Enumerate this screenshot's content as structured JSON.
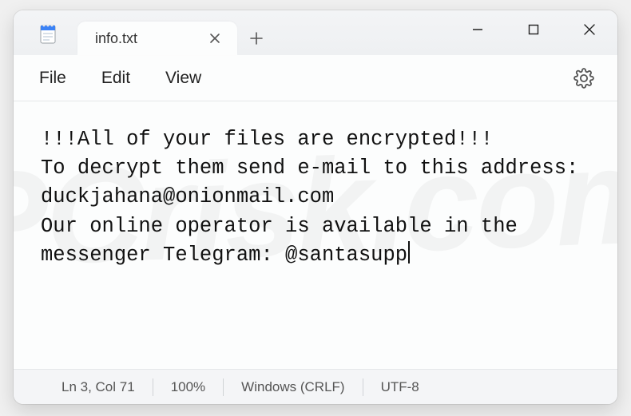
{
  "tab": {
    "title": "info.txt"
  },
  "menubar": {
    "file": "File",
    "edit": "Edit",
    "view": "View"
  },
  "document": {
    "text": "!!!All of your files are encrypted!!!\nTo decrypt them send e-mail to this address: duckjahana@onionmail.com\nOur online operator is available in the messenger Telegram: @santasupp"
  },
  "statusbar": {
    "position": "Ln 3, Col 71",
    "zoom": "100%",
    "line_ending": "Windows (CRLF)",
    "encoding": "UTF-8"
  },
  "icons": {
    "app": "notepad-icon",
    "tab_close": "close-icon",
    "new_tab": "plus-icon",
    "minimize": "minimize-icon",
    "maximize": "maximize-icon",
    "window_close": "close-icon",
    "settings": "gear-icon"
  }
}
